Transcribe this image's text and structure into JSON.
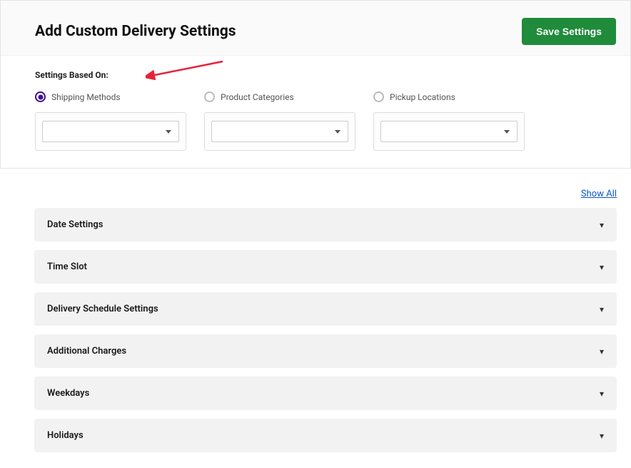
{
  "header": {
    "title": "Add Custom Delivery Settings",
    "save_label": "Save Settings"
  },
  "based_on": {
    "label": "Settings Based On:",
    "options": [
      {
        "label": "Shipping Methods",
        "selected": true
      },
      {
        "label": "Product Categories",
        "selected": false
      },
      {
        "label": "Pickup Locations",
        "selected": false
      }
    ]
  },
  "show_all": "Show All",
  "accordion": [
    {
      "label": "Date Settings"
    },
    {
      "label": "Time Slot"
    },
    {
      "label": "Delivery Schedule Settings"
    },
    {
      "label": "Additional Charges"
    },
    {
      "label": "Weekdays"
    },
    {
      "label": "Holidays"
    }
  ],
  "annotations": {
    "arrow_color": "#e6223a"
  }
}
